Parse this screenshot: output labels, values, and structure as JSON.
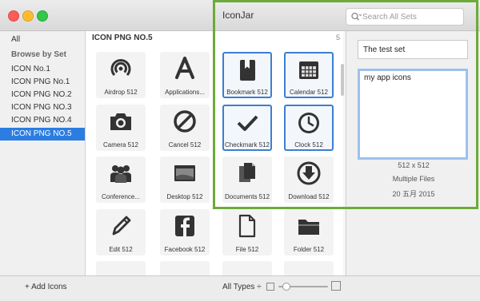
{
  "app_title": "IconJar",
  "search": {
    "placeholder": "Search All Sets"
  },
  "sidebar": {
    "items": [
      {
        "label": "All",
        "kind": "item"
      },
      {
        "label": "Browse by Set",
        "kind": "heading"
      },
      {
        "label": "ICON  No.1",
        "kind": "item"
      },
      {
        "label": "ICON PNG No.1",
        "kind": "item"
      },
      {
        "label": "ICON PNG NO.2",
        "kind": "item"
      },
      {
        "label": "ICON PNG NO.3",
        "kind": "item"
      },
      {
        "label": "ICON PNG NO.4",
        "kind": "item"
      },
      {
        "label": "ICON PNG NO.5",
        "kind": "item",
        "selected": true
      }
    ]
  },
  "content": {
    "set_title": "ICON PNG NO.5",
    "count": "5",
    "icons": [
      {
        "label": "Airdrop 512",
        "icon": "airdrop-icon"
      },
      {
        "label": "Applications...",
        "icon": "applications-icon"
      },
      {
        "label": "Bookmark 512",
        "icon": "bookmark-icon",
        "selected": true
      },
      {
        "label": "Calendar 512",
        "icon": "calendar-icon",
        "selected": true
      },
      {
        "label": "Camera 512",
        "icon": "camera-icon"
      },
      {
        "label": "Cancel 512",
        "icon": "cancel-icon"
      },
      {
        "label": "Checkmark 512",
        "icon": "checkmark-icon",
        "selected": true
      },
      {
        "label": "Clock 512",
        "icon": "clock-icon",
        "selected": true
      },
      {
        "label": "Conference...",
        "icon": "conference-icon"
      },
      {
        "label": "Desktop 512",
        "icon": "desktop-icon"
      },
      {
        "label": "Documents 512",
        "icon": "documents-icon"
      },
      {
        "label": "Download 512",
        "icon": "download-icon"
      },
      {
        "label": "Edit 512",
        "icon": "edit-icon"
      },
      {
        "label": "Facebook 512",
        "icon": "facebook-icon"
      },
      {
        "label": "File 512",
        "icon": "file-icon"
      },
      {
        "label": "Folder 512",
        "icon": "folder-icon"
      }
    ]
  },
  "inspector": {
    "set_name": "The test set",
    "description": "my app icons",
    "dimensions": "512 x 512",
    "files": "Multiple Files",
    "date": "20 五月 2015"
  },
  "bottom": {
    "add_label": "+ Add Icons",
    "types_label": "All Types ÷"
  },
  "colors": {
    "accent": "#2b7de1",
    "selection_border": "#3a7fd0",
    "highlight": "#6cab3a"
  }
}
